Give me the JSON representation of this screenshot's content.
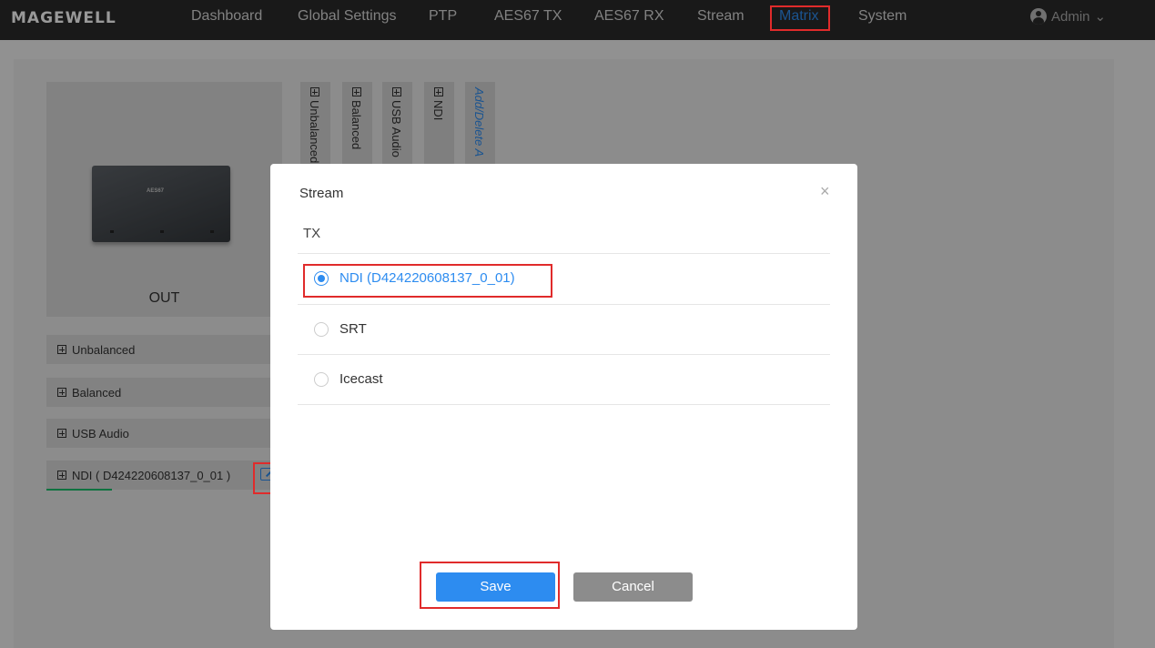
{
  "app": {
    "logo": "MAGEWELL"
  },
  "nav": {
    "items": [
      {
        "label": "Dashboard"
      },
      {
        "label": "Global Settings"
      },
      {
        "label": "PTP"
      },
      {
        "label": "AES67 TX"
      },
      {
        "label": "AES67 RX"
      },
      {
        "label": "Stream"
      },
      {
        "label": "Matrix",
        "active": true
      },
      {
        "label": "System"
      }
    ],
    "user": "Admin"
  },
  "matrix": {
    "device_label": "OUT",
    "device_brand": "AES67",
    "vertical_tabs": [
      "Unbalanced",
      "Balanced",
      "USB Audio",
      "NDI"
    ],
    "add_delete_link": "Add/Delete A",
    "rows": [
      {
        "label": "Unbalanced"
      },
      {
        "label": "Balanced"
      },
      {
        "label": "USB Audio"
      },
      {
        "label": "NDI ( D424220608137_0_01 )"
      }
    ]
  },
  "modal": {
    "title": "Stream",
    "close": "×",
    "section": "TX",
    "options": [
      {
        "label": "NDI (D424220608137_0_01)",
        "selected": true
      },
      {
        "label": "SRT",
        "selected": false
      },
      {
        "label": "Icecast",
        "selected": false
      }
    ],
    "save_label": "Save",
    "cancel_label": "Cancel"
  },
  "colors": {
    "accent": "#2d8cf0",
    "highlight": "#e02b2b",
    "topbar": "#2b2b2b"
  }
}
